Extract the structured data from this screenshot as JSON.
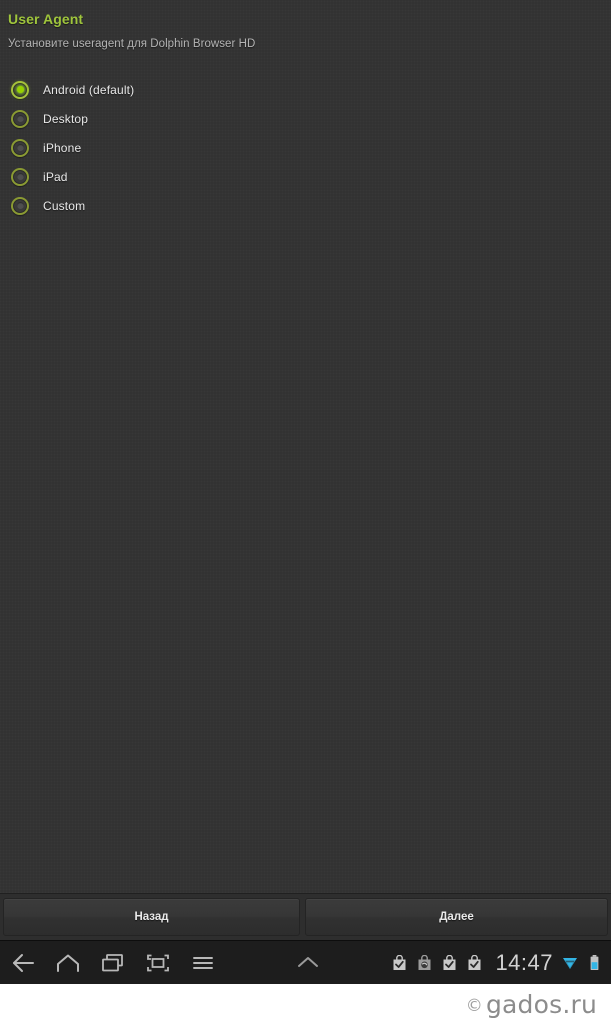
{
  "app": {
    "title": "User Agent",
    "subtitle": "Установите useragent для Dolphin Browser HD",
    "title_color": "#9fc53c",
    "background_color": "#333333"
  },
  "options": {
    "selected_index": 0,
    "items": [
      {
        "label": "Android (default)",
        "selected": true
      },
      {
        "label": "Desktop",
        "selected": false
      },
      {
        "label": "iPhone",
        "selected": false
      },
      {
        "label": "iPad",
        "selected": false
      },
      {
        "label": "Custom",
        "selected": false
      }
    ]
  },
  "wizard_buttons": {
    "back_label": "Назад",
    "next_label": "Далее"
  },
  "system_bar": {
    "nav_icons": [
      "back-arrow-icon",
      "home-icon",
      "recent-apps-icon",
      "screenshot-icon",
      "menu-icon"
    ],
    "chevron_icon": "chevron-up-icon",
    "status_icons": [
      "play-store-download-complete-icon",
      "play-store-downloading-icon",
      "play-store-download-complete-icon",
      "play-store-download-complete-icon"
    ],
    "clock": "14:47",
    "wifi_icon": "wifi-signal-icon",
    "battery_icon": "battery-icon",
    "accent_color": "#33b5e5"
  },
  "watermark": {
    "copyright_symbol": "©",
    "text": "gados.ru"
  }
}
